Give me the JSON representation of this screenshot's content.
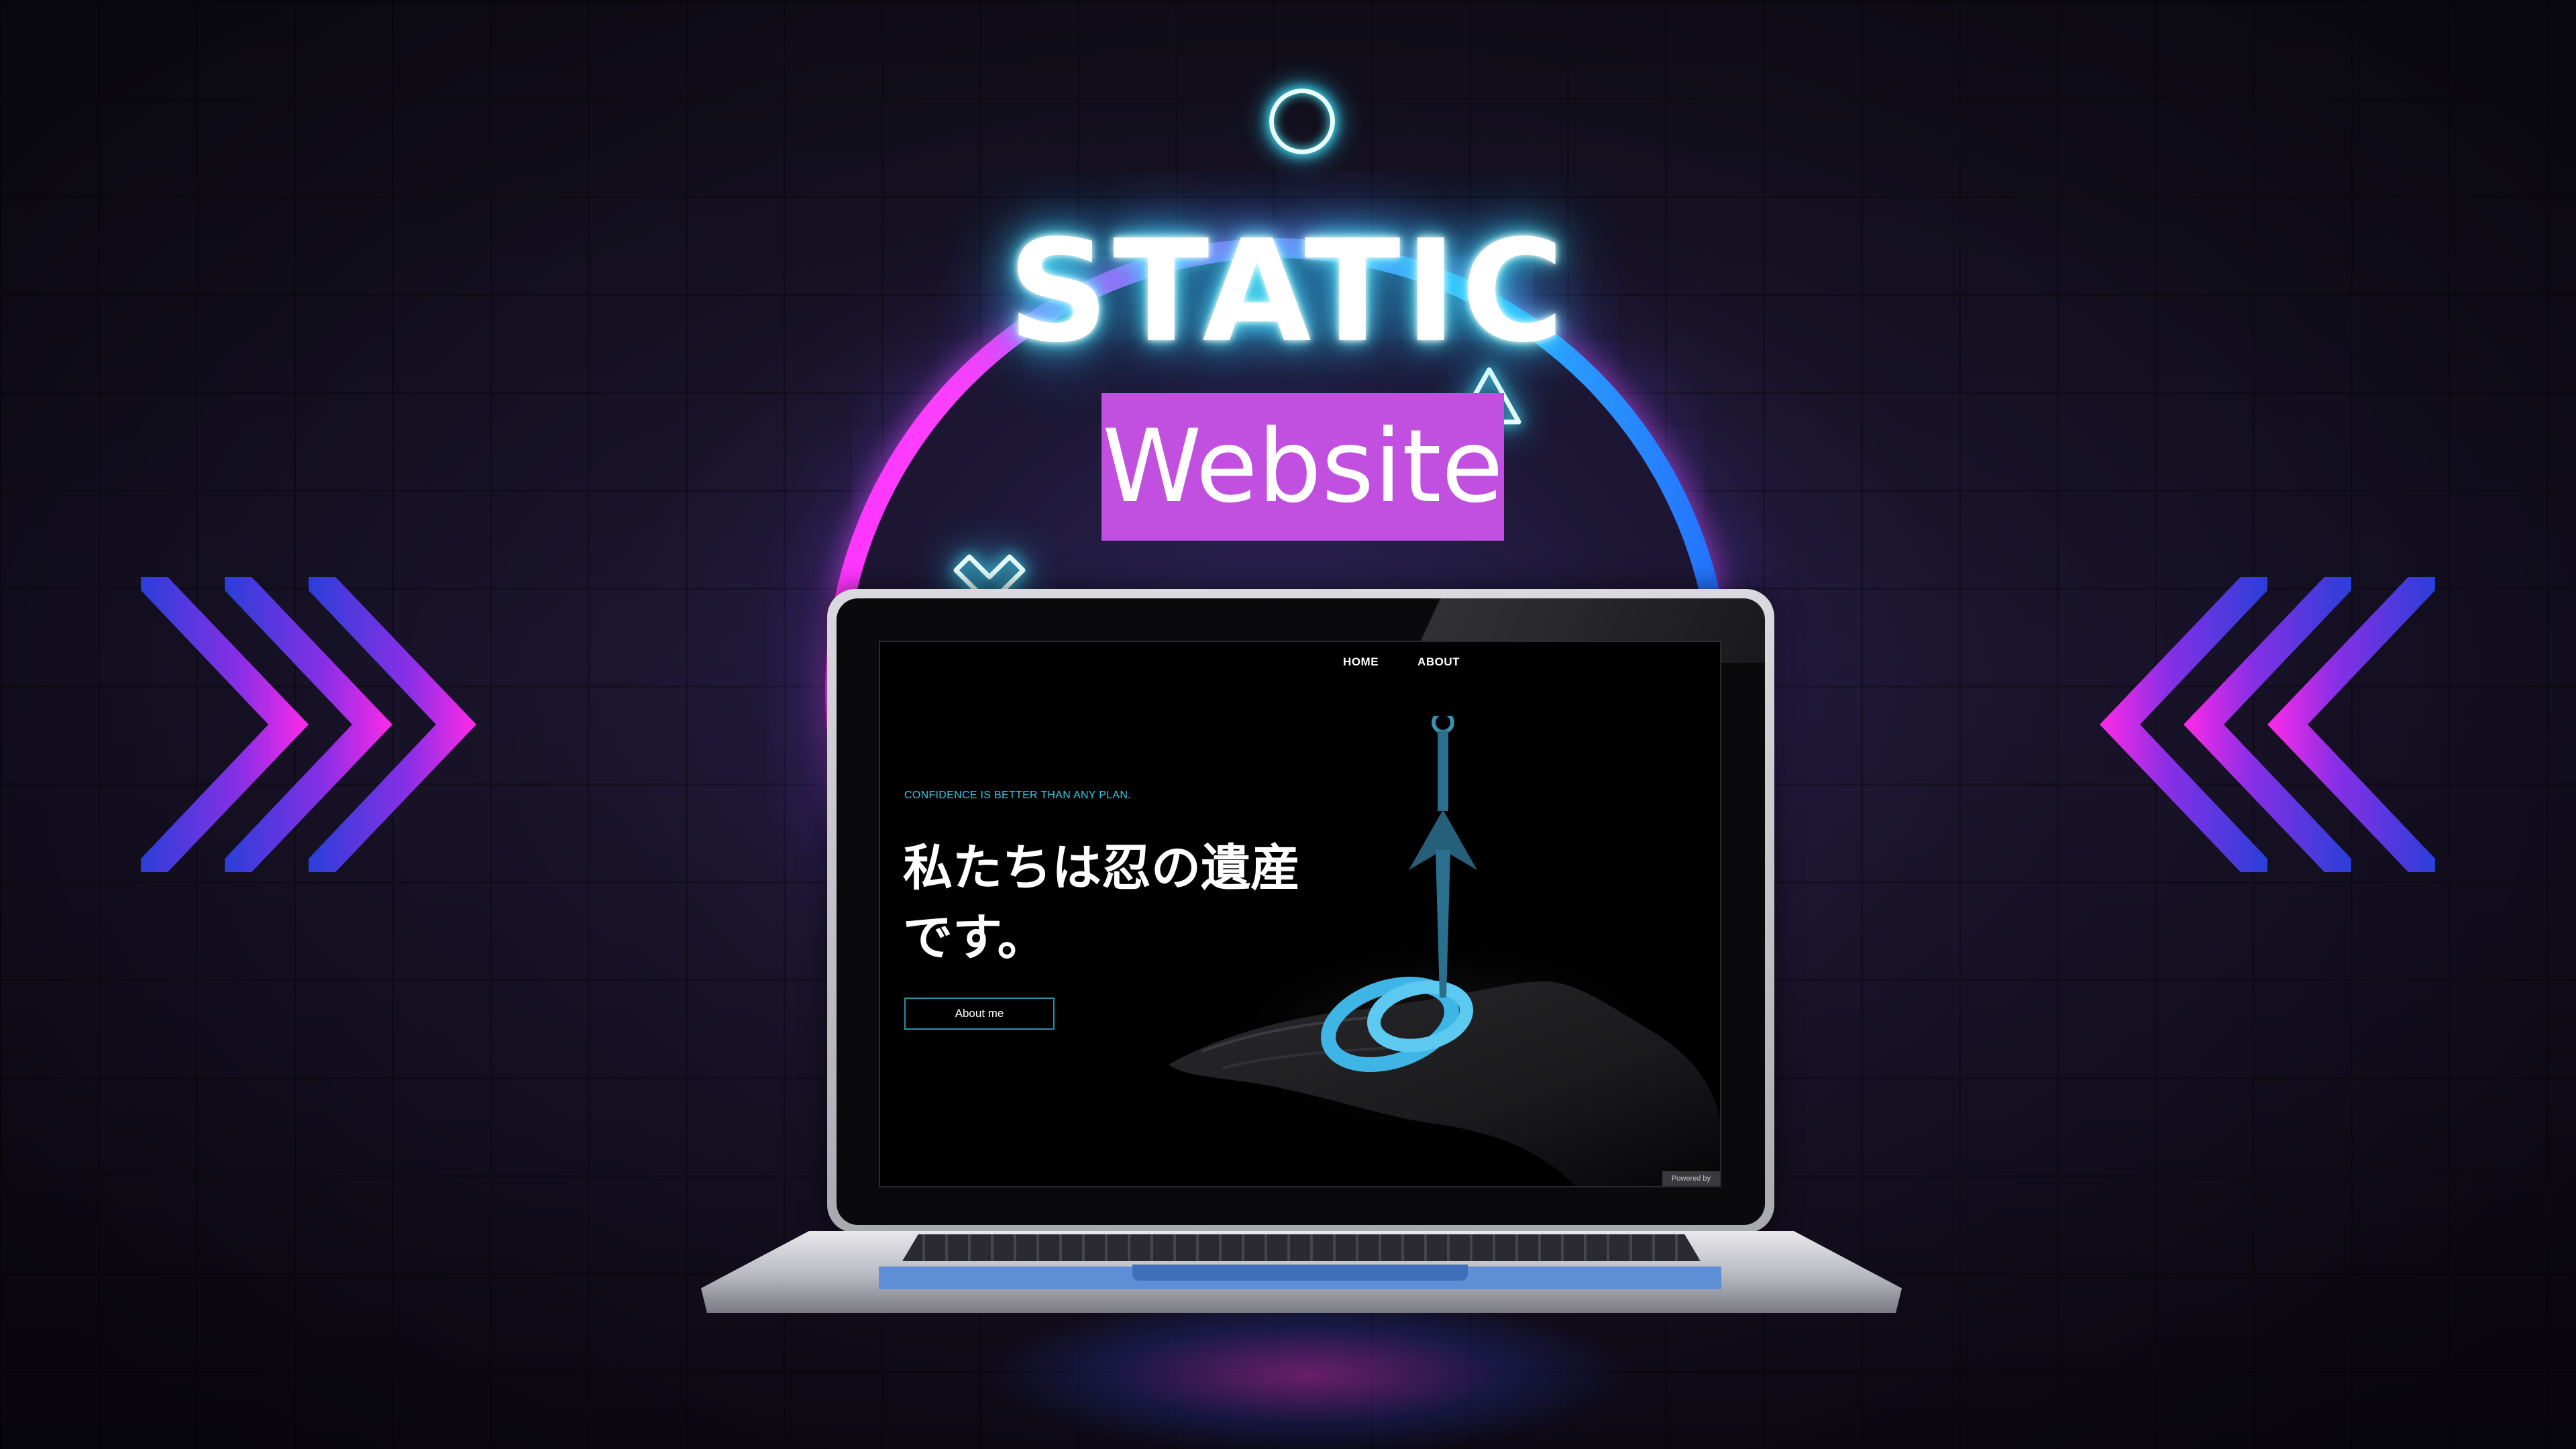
{
  "title": {
    "main": "STATIC",
    "sub": "Website"
  },
  "site": {
    "nav": {
      "home": "HOME",
      "about": "ABOUT"
    },
    "tagline": "CONFIDENCE IS BETTER THAN ANY PLAN.",
    "heading": "私たちは忍の遺産です。",
    "button": "About me",
    "badge": "Powered by"
  },
  "icons": {
    "top": "circle-icon",
    "right": "triangle-icon",
    "left": "cross-icon",
    "chevrons_left": "chevron-right-icon",
    "chevrons_right": "chevron-left-icon"
  },
  "colors": {
    "neon_cyan": "#4ff0ff",
    "neon_pink": "#ff3cf0",
    "neon_blue": "#2c6dff",
    "label_box": "#c14fe0",
    "tagline": "#35c8e6"
  }
}
